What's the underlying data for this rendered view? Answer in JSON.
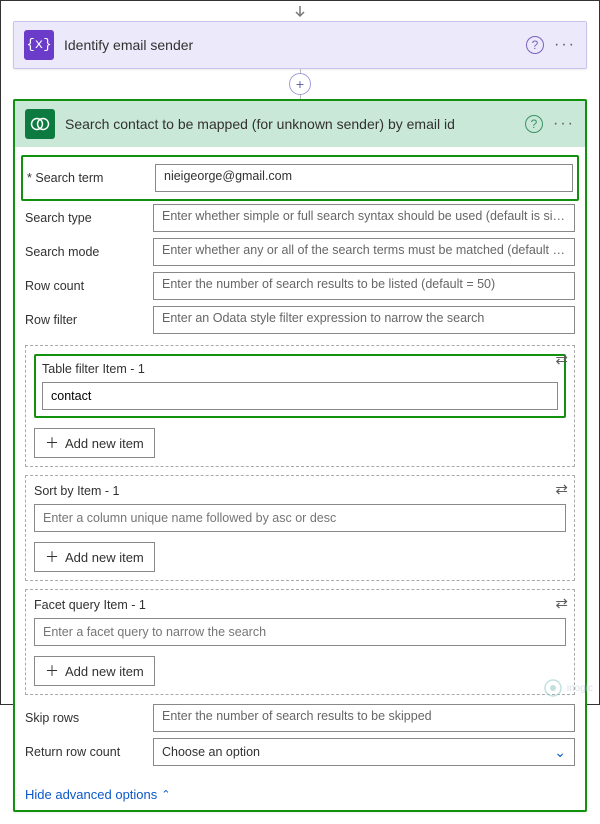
{
  "step1": {
    "title": "Identify email sender"
  },
  "add_icon": "+",
  "step2": {
    "title": "Search contact to be mapped (for unknown sender) by email id",
    "fields": {
      "search_term": {
        "label": "Search term",
        "value": "nieigeorge@gmail.com"
      },
      "search_type": {
        "label": "Search type",
        "placeholder": "Enter whether simple or full search syntax should be used (default is simple)"
      },
      "search_mode": {
        "label": "Search mode",
        "placeholder": "Enter whether any or all of the search terms must be matched (default is any)"
      },
      "row_count": {
        "label": "Row count",
        "placeholder": "Enter the number of search results to be listed (default = 50)"
      },
      "row_filter": {
        "label": "Row filter",
        "placeholder": "Enter an Odata style filter expression to narrow the search"
      },
      "skip_rows": {
        "label": "Skip rows",
        "placeholder": "Enter the number of search results to be skipped"
      },
      "return_row_count": {
        "label": "Return row count",
        "value": "Choose an option"
      }
    },
    "arrays": {
      "table_filter": {
        "title": "Table filter Item - 1",
        "value": "contact",
        "switch_icon": "switch-to-array-icon"
      },
      "sort_by": {
        "title": "Sort by Item - 1",
        "placeholder": "Enter a column unique name followed by asc or desc",
        "switch_icon": "switch-to-array-icon"
      },
      "facet_query": {
        "title": "Facet query Item - 1",
        "placeholder": "Enter a facet query to narrow the search",
        "switch_icon": "switch-to-array-icon"
      }
    },
    "add_item_label": "Add new item",
    "hide_advanced": "Hide advanced options"
  },
  "watermark": "inogic"
}
